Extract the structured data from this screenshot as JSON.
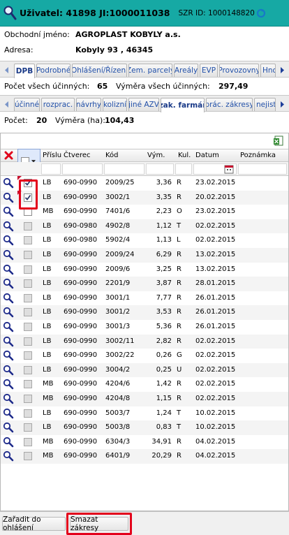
{
  "header": {
    "user": "Uživatel: 41898 JI:1000011038",
    "szr": "SZR ID: 1000148820"
  },
  "info": [
    {
      "label": "Obchodní jméno:",
      "value": "AGROPLAST KOBYLY a.s."
    },
    {
      "label": "Adresa:",
      "value": "Kobyly 93 , 46345"
    }
  ],
  "tabs1": [
    "DPB",
    "Podrobné",
    "Ohlášení/Řízení",
    "Zem. parcely",
    "Areály",
    "EVP",
    "Provozovny",
    "Hno"
  ],
  "stats1": {
    "count_label": "Počet všech účinných:",
    "count": "65",
    "area_label": "Výměra všech účinných:",
    "area": "297,49"
  },
  "tabs2": [
    "účinné",
    "rozprac.",
    "návrhy",
    "kolizní",
    "jiné AZV",
    "zak. farmář",
    "prác. zákresy",
    "nejiste"
  ],
  "stats2": {
    "count_label": "Počet:",
    "count": "20",
    "area_label": "Výměra (ha):",
    "area": "104,43"
  },
  "grid": {
    "columns": [
      "Příslu",
      "Čtverec",
      "Kód",
      "Vým.",
      "Kul.",
      "Datum",
      "Poznámka"
    ],
    "rows": [
      {
        "prislu": "LB",
        "ctverec": "690-0990",
        "kod": "2009/25",
        "vym": "3,36",
        "kul": "R",
        "datum": "23.02.2015",
        "checked": true,
        "grey": false
      },
      {
        "prislu": "LB",
        "ctverec": "690-0990",
        "kod": "3002/1",
        "vym": "3,35",
        "kul": "R",
        "datum": "20.02.2015",
        "checked": true,
        "grey": false
      },
      {
        "prislu": "MB",
        "ctverec": "690-0990",
        "kod": "7401/6",
        "vym": "2,23",
        "kul": "O",
        "datum": "23.02.2015",
        "checked": false,
        "grey": false
      },
      {
        "prislu": "LB",
        "ctverec": "690-0980",
        "kod": "4902/8",
        "vym": "1,12",
        "kul": "T",
        "datum": "02.02.2015",
        "checked": false,
        "grey": true
      },
      {
        "prislu": "LB",
        "ctverec": "690-0980",
        "kod": "5902/4",
        "vym": "1,13",
        "kul": "L",
        "datum": "02.02.2015",
        "checked": false,
        "grey": true
      },
      {
        "prislu": "LB",
        "ctverec": "690-0990",
        "kod": "2009/24",
        "vym": "6,29",
        "kul": "R",
        "datum": "13.02.2015",
        "checked": false,
        "grey": true
      },
      {
        "prislu": "LB",
        "ctverec": "690-0990",
        "kod": "2009/6",
        "vym": "3,25",
        "kul": "R",
        "datum": "13.02.2015",
        "checked": false,
        "grey": true
      },
      {
        "prislu": "LB",
        "ctverec": "690-0990",
        "kod": "2201/9",
        "vym": "3,87",
        "kul": "R",
        "datum": "28.01.2015",
        "checked": false,
        "grey": true
      },
      {
        "prislu": "LB",
        "ctverec": "690-0990",
        "kod": "3001/1",
        "vym": "7,77",
        "kul": "R",
        "datum": "26.01.2015",
        "checked": false,
        "grey": true
      },
      {
        "prislu": "LB",
        "ctverec": "690-0990",
        "kod": "3001/2",
        "vym": "3,53",
        "kul": "R",
        "datum": "26.01.2015",
        "checked": false,
        "grey": true
      },
      {
        "prislu": "LB",
        "ctverec": "690-0990",
        "kod": "3001/3",
        "vym": "5,36",
        "kul": "R",
        "datum": "26.01.2015",
        "checked": false,
        "grey": true
      },
      {
        "prislu": "LB",
        "ctverec": "690-0990",
        "kod": "3002/11",
        "vym": "2,82",
        "kul": "R",
        "datum": "02.02.2015",
        "checked": false,
        "grey": true
      },
      {
        "prislu": "LB",
        "ctverec": "690-0990",
        "kod": "3002/22",
        "vym": "0,26",
        "kul": "G",
        "datum": "02.02.2015",
        "checked": false,
        "grey": true
      },
      {
        "prislu": "LB",
        "ctverec": "690-0990",
        "kod": "3004/2",
        "vym": "0,25",
        "kul": "U",
        "datum": "02.02.2015",
        "checked": false,
        "grey": true
      },
      {
        "prislu": "MB",
        "ctverec": "690-0990",
        "kod": "4204/6",
        "vym": "1,42",
        "kul": "R",
        "datum": "02.02.2015",
        "checked": false,
        "grey": true
      },
      {
        "prislu": "MB",
        "ctverec": "690-0990",
        "kod": "4204/8",
        "vym": "1,15",
        "kul": "R",
        "datum": "02.02.2015",
        "checked": false,
        "grey": true
      },
      {
        "prislu": "LB",
        "ctverec": "690-0990",
        "kod": "5003/7",
        "vym": "1,24",
        "kul": "T",
        "datum": "10.02.2015",
        "checked": false,
        "grey": true
      },
      {
        "prislu": "LB",
        "ctverec": "690-0990",
        "kod": "5003/8",
        "vym": "0,83",
        "kul": "T",
        "datum": "10.02.2015",
        "checked": false,
        "grey": true
      },
      {
        "prislu": "MB",
        "ctverec": "690-0990",
        "kod": "6304/3",
        "vym": "34,91",
        "kul": "R",
        "datum": "04.02.2015",
        "checked": false,
        "grey": true
      },
      {
        "prislu": "MB",
        "ctverec": "690-0990",
        "kod": "6401/9",
        "vym": "20,29",
        "kul": "R",
        "datum": "04.02.2015",
        "checked": false,
        "grey": true
      }
    ]
  },
  "buttons": {
    "assign": "Zařadit do ohlášení",
    "delete": "Smazat zákresy"
  },
  "colors": {
    "header": "#16a9a4",
    "highlight": "#e3001b",
    "tab_text": "#2250a8"
  },
  "icons": [
    "magnifier-icon",
    "refresh-icon",
    "arrow-left-icon",
    "arrow-right-icon",
    "excel-export-icon",
    "clear-filter-icon",
    "calendar-icon",
    "detail-magnifier-icon"
  ]
}
